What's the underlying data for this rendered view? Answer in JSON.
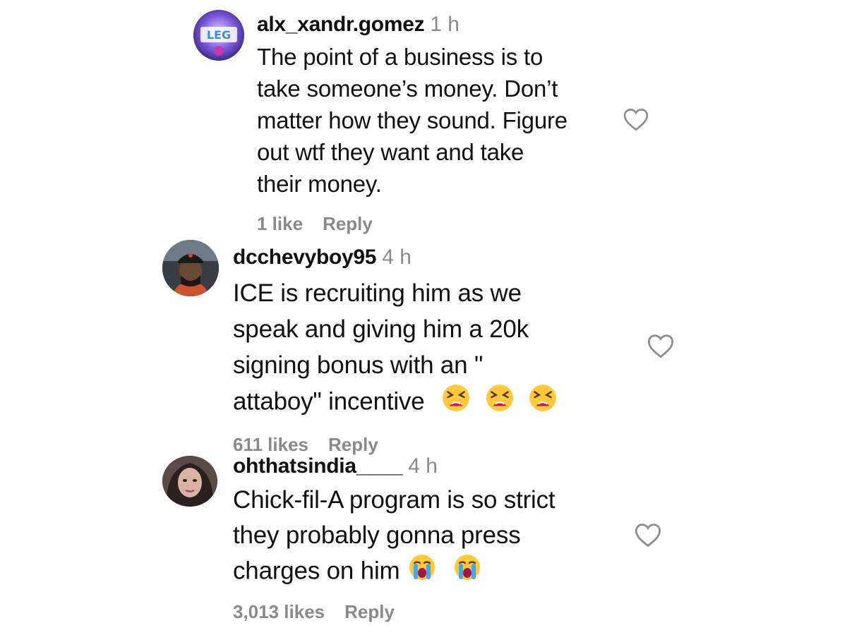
{
  "comments": [
    {
      "username": "alx_xandr.gomez",
      "time": "1 h",
      "lines": [
        "The point of a business is to",
        "take someone’s money. Don’t",
        "matter how they sound. Figure",
        "out wtf they want and take",
        "their money."
      ],
      "likes": "1 like",
      "reply": "Reply",
      "avatar_icon": "gaming-logo-avatar"
    },
    {
      "username": "dcchevyboy95",
      "time": "4 h",
      "lines": [
        "ICE is recruiting him as we",
        "speak and giving him a 20k",
        "signing bonus with an \"",
        "attaboy\" incentive"
      ],
      "emojis": [
        "tired-face-emoji",
        "tired-face-emoji",
        "tired-face-emoji"
      ],
      "likes": "611 likes",
      "reply": "Reply",
      "avatar_icon": "person-in-cap-avatar"
    },
    {
      "username": "ohthatsindia____",
      "time": "4 h",
      "lines": [
        "Chick-fil-A program is so strict",
        "they probably gonna press",
        "charges on him"
      ],
      "emojis": [
        "loudly-crying-face-emoji",
        "loudly-crying-face-emoji"
      ],
      "likes": "3,013 likes",
      "reply": "Reply",
      "avatar_icon": "person-selfie-avatar"
    }
  ],
  "colors": {
    "text": "#111111",
    "muted": "#8a8a8a",
    "background": "#ffffff"
  }
}
